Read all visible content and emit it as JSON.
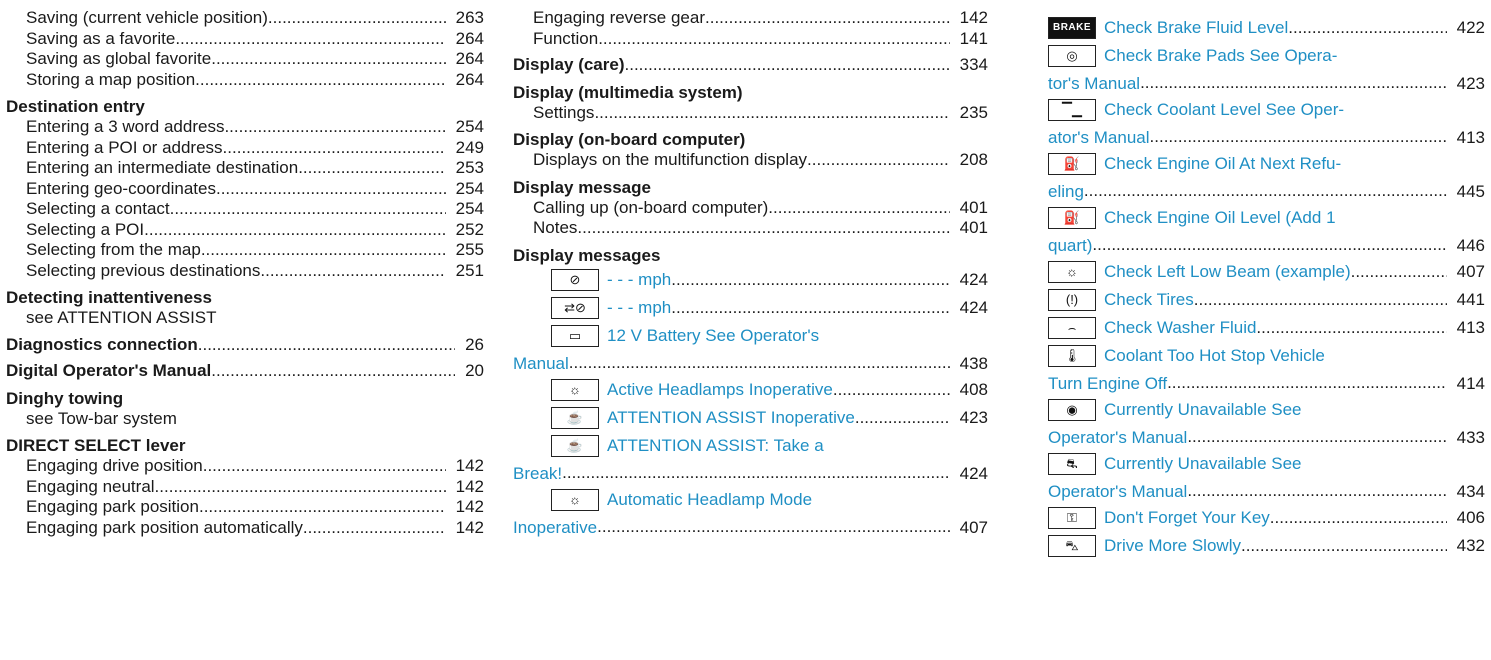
{
  "col1": {
    "top_subs": [
      {
        "text": "Saving (current vehicle position)",
        "page": "263"
      },
      {
        "text": "Saving as a favorite",
        "page": "264"
      },
      {
        "text": "Saving as global favorite",
        "page": "264"
      },
      {
        "text": "Storing a map position",
        "page": "264"
      }
    ],
    "destination_entry": {
      "heading": "Destination entry",
      "subs": [
        {
          "text": "Entering a 3 word address",
          "page": "254"
        },
        {
          "text": "Entering a POI or address",
          "page": "249"
        },
        {
          "text": "Entering an intermediate destination",
          "page": "253"
        },
        {
          "text": "Entering geo-coordinates",
          "page": "254"
        },
        {
          "text": "Selecting a contact",
          "page": "254"
        },
        {
          "text": "Selecting a POI",
          "page": "252"
        },
        {
          "text": "Selecting from the map",
          "page": "255"
        },
        {
          "text": "Selecting previous destinations",
          "page": "251"
        }
      ]
    },
    "detecting": {
      "heading": "Detecting inattentiveness",
      "see": "see ATTENTION ASSIST"
    },
    "diagnostics": {
      "heading": "Diagnostics connection",
      "page": "26"
    },
    "digital_manual": {
      "heading": "Digital Operator's Manual",
      "page": "20"
    },
    "dinghy": {
      "heading": "Dinghy towing",
      "see": "see Tow-bar system"
    },
    "direct_select": {
      "heading": "DIRECT SELECT lever",
      "subs": [
        {
          "text": "Engaging drive position",
          "page": "142"
        },
        {
          "text": "Engaging neutral",
          "page": "142"
        },
        {
          "text": "Engaging park position",
          "page": "142"
        },
        {
          "text": "Engaging park position automatically",
          "page": "142"
        }
      ]
    }
  },
  "col2": {
    "top_subs": [
      {
        "text": "Engaging reverse gear",
        "page": "142"
      },
      {
        "text": "Function",
        "page": "141"
      }
    ],
    "display_care": {
      "heading": "Display (care)",
      "page": "334"
    },
    "display_multimedia": {
      "heading": "Display (multimedia system)",
      "subs": [
        {
          "text": "Settings",
          "page": "235"
        }
      ]
    },
    "display_onboard": {
      "heading": "Display (on-board computer)",
      "subs": [
        {
          "text": "Displays on the multifunction display",
          "page": "208"
        }
      ]
    },
    "display_message": {
      "heading": "Display message",
      "subs": [
        {
          "text": "Calling up (on-board computer)",
          "page": "401"
        },
        {
          "text": "Notes",
          "page": "401"
        }
      ]
    },
    "display_messages": {
      "heading": "Display messages",
      "entries": [
        {
          "icon": "speedometer-icon",
          "glyph": "⊘",
          "line1": "- - - mph",
          "line2": "",
          "page": "424"
        },
        {
          "icon": "car-speed-icon",
          "glyph": "⇄⊘",
          "line1": "- - - mph",
          "line2": "",
          "page": "424"
        },
        {
          "icon": "battery-icon",
          "glyph": "▭",
          "line1": "12 V Battery See Operator's",
          "line2": "Manual",
          "page": "438"
        },
        {
          "icon": "headlamp-icon",
          "glyph": "☼",
          "line1": "Active Headlamps Inoperative",
          "line2": "",
          "page": "408"
        },
        {
          "icon": "coffee-cup-icon",
          "glyph": "☕",
          "line1": "ATTENTION ASSIST Inoperative",
          "line2": "",
          "page": "423"
        },
        {
          "icon": "coffee-cup-icon",
          "glyph": "☕",
          "line1": "ATTENTION ASSIST: Take a",
          "line2": "Break!",
          "page": "424"
        },
        {
          "icon": "headlamp-icon",
          "glyph": "☼",
          "line1": "Automatic Headlamp Mode",
          "line2": "Inoperative",
          "page": "407"
        }
      ]
    }
  },
  "col3": {
    "entries": [
      {
        "icon": "brake-icon",
        "glyph": "BRAKE",
        "line1": "Check Brake Fluid Level",
        "line2": "",
        "page": "422"
      },
      {
        "icon": "brake-pad-icon",
        "glyph": "◎",
        "line1": "Check Brake Pads See Opera-",
        "line2": "tor's Manual",
        "page": "423"
      },
      {
        "icon": "coolant-icon",
        "glyph": "▔▁",
        "line1": "Check Coolant Level See Oper-",
        "line2": "ator's Manual",
        "page": "413"
      },
      {
        "icon": "oil-can-icon",
        "glyph": "⛽",
        "line1": "Check Engine Oil At Next Refu-",
        "line2": "eling",
        "page": "445"
      },
      {
        "icon": "oil-can-icon",
        "glyph": "⛽",
        "line1": "Check Engine Oil Level (Add 1",
        "line2": "quart)",
        "page": "446"
      },
      {
        "icon": "headlamp-icon",
        "glyph": "☼",
        "line1": "Check Left Low Beam (example)",
        "line2": "",
        "page": "407"
      },
      {
        "icon": "tire-icon",
        "glyph": "(!)",
        "line1": "Check Tires",
        "line2": "",
        "page": "441"
      },
      {
        "icon": "washer-fluid-icon",
        "glyph": "⌢",
        "line1": "Check Washer Fluid",
        "line2": "",
        "page": "413"
      },
      {
        "icon": "thermometer-icon",
        "glyph": "🌡",
        "line1": "Coolant Too Hot Stop Vehicle",
        "line2": "Turn Engine Off",
        "page": "414"
      },
      {
        "icon": "abs-icon",
        "glyph": "◉",
        "line1": "Currently Unavailable See",
        "line2": "Operator's Manual",
        "page": "433"
      },
      {
        "icon": "car-skid-icon",
        "glyph": "⛐",
        "line1": "Currently Unavailable See",
        "line2": "Operator's Manual",
        "page": "434"
      },
      {
        "icon": "key-icon",
        "glyph": "⚿",
        "line1": "Don't Forget Your Key",
        "line2": "",
        "page": "406"
      },
      {
        "icon": "slow-car-icon",
        "glyph": "⛍",
        "line1": "Drive More Slowly",
        "line2": "",
        "page": "432"
      }
    ]
  }
}
